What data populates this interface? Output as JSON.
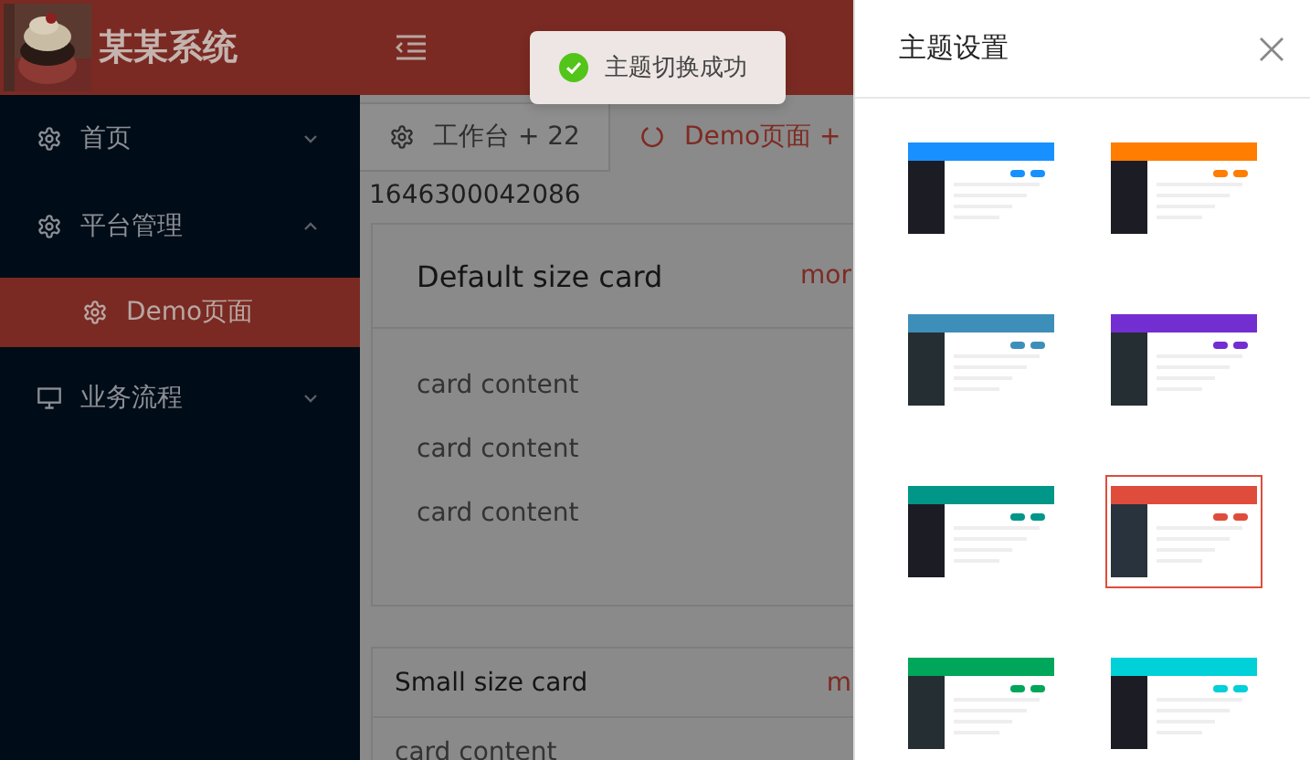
{
  "app": {
    "title": "某某系统"
  },
  "sidebar": {
    "items": [
      {
        "label": "首页",
        "expanded": false
      },
      {
        "label": "平台管理",
        "expanded": true,
        "children": [
          {
            "label": "Demo页面",
            "selected": true
          }
        ]
      },
      {
        "label": "业务流程",
        "expanded": false
      }
    ]
  },
  "tabs": [
    {
      "label": "工作台 + 22",
      "selected": false
    },
    {
      "label": "Demo页面 +",
      "selected": true
    }
  ],
  "timestamp": "1646300042086",
  "cards": [
    {
      "kind": "default",
      "title": "Default size card",
      "extra": "mor",
      "lines": [
        "card content",
        "card content",
        "card content"
      ]
    },
    {
      "kind": "small",
      "title": "Small size card",
      "extra": "m",
      "lines": [
        "card content"
      ]
    }
  ],
  "toast": {
    "kind": "success",
    "text": "主题切换成功"
  },
  "drawer": {
    "title": "主题设置",
    "themes": [
      {
        "color": "#1890ff",
        "selected": false
      },
      {
        "color": "#ff7d00",
        "selected": false
      },
      {
        "color": "#3e8eba",
        "selected": false
      },
      {
        "color": "#722ed1",
        "selected": false
      },
      {
        "color": "#009688",
        "selected": false
      },
      {
        "color": "#e04c3b",
        "selected": true
      },
      {
        "color": "#00a65a",
        "selected": false
      },
      {
        "color": "#00d0d8",
        "selected": false
      }
    ]
  }
}
